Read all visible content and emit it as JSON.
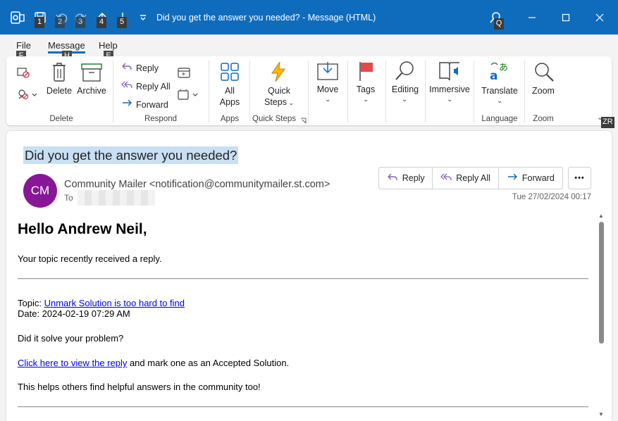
{
  "titlebar": {
    "title": "Did you get the answer you needed?  -  Message (HTML)",
    "keytips": [
      "1",
      "2",
      "3",
      "4",
      "5"
    ],
    "search_keytip": "Q"
  },
  "menu": {
    "items": [
      {
        "label": "File",
        "keytip": "F"
      },
      {
        "label": "Message",
        "keytip": "H"
      },
      {
        "label": "Help",
        "keytip": "E"
      }
    ],
    "collapse_keytip": "ZR"
  },
  "ribbon": {
    "delete_group": {
      "delete": "Delete",
      "archive": "Archive",
      "name": "Delete"
    },
    "respond_group": {
      "reply": "Reply",
      "reply_all": "Reply All",
      "forward": "Forward",
      "name": "Respond"
    },
    "apps_group": {
      "all_apps_line1": "All",
      "all_apps_line2": "Apps",
      "name": "Apps"
    },
    "quicksteps_group": {
      "line1": "Quick",
      "line2": "Steps",
      "name": "Quick Steps"
    },
    "move": "Move",
    "tags": "Tags",
    "editing": "Editing",
    "immersive": "Immersive",
    "language_group": {
      "translate": "Translate",
      "name": "Language"
    },
    "zoom_group": {
      "zoom": "Zoom",
      "name": "Zoom"
    }
  },
  "message": {
    "subject": "Did you get the answer you needed?",
    "avatar_initials": "CM",
    "avatar_color": "#881798",
    "sender": "Community Mailer <notification@communitymailer.st.com>",
    "to_label": "To",
    "date": "Tue 27/02/2024 00:17",
    "actions": {
      "reply": "Reply",
      "reply_all": "Reply All",
      "forward": "Forward",
      "more": "•••"
    }
  },
  "body": {
    "greeting": "Hello Andrew Neil,",
    "intro": "Your topic recently received a reply.",
    "topic_label": "Topic: ",
    "topic_link": "Unmark Solution is too hard to find",
    "date_line": "Date: 2024-02-19 07:29 AM",
    "question": "Did it solve your problem?",
    "view_link": "Click here to view the reply",
    "view_rest": " and mark one as an Accepted Solution.",
    "helps": "This helps others find helpful answers in the community too!"
  },
  "colors": {
    "accent": "#0f6cbd",
    "subject_highlight": "#c7e0f4",
    "link": "#0000ee"
  }
}
